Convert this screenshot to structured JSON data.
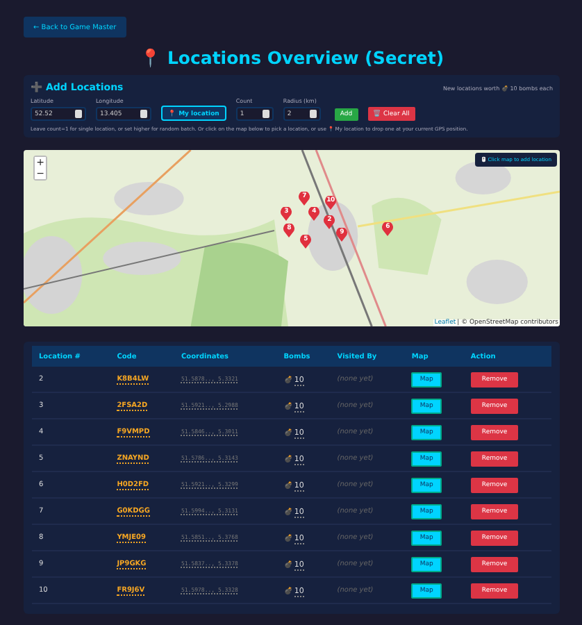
{
  "back_button": "← Back to Game Master",
  "title": {
    "icon": "📍",
    "text": "Locations Overview (Secret)"
  },
  "add_panel": {
    "heading_icon": "➕",
    "heading": "Add Locations",
    "note": "New locations worth 💣 10 bombs each",
    "fields": [
      {
        "label": "Latitude",
        "value": "52.52"
      },
      {
        "label": "Longitude",
        "value": "13.405"
      }
    ],
    "my_location": "📍 My location",
    "fields2": [
      {
        "label": "Count",
        "value": "1"
      },
      {
        "label": "Radius (km)",
        "value": "2"
      }
    ],
    "add": "Add",
    "clear": "🗑️ Clear All",
    "help": "Leave count=1 for single location, or set higher for random batch. Or click on the map below to pick a location, or use 📍 My location to drop one at your current GPS position."
  },
  "map": {
    "zoom_in": "+",
    "zoom_out": "−",
    "hint": "🖱️ Click map to add location",
    "attribution_link": "Leaflet",
    "attribution": "| © OpenStreetMap contributors",
    "markers": [
      "7",
      "10",
      "3",
      "4",
      "2",
      "8",
      "9",
      "5",
      "6"
    ]
  },
  "table": {
    "columns": [
      "Location #",
      "Code",
      "Coordinates",
      "Bombs",
      "Visited By",
      "Map",
      "Action"
    ],
    "rows": [
      {
        "number": "2",
        "code": "K8B4LW",
        "coords": "51.5878.., 5.3321",
        "bomb_icon": "💣",
        "bombs": "10",
        "visited": "(none yet)",
        "map": "Map",
        "action": "Remove"
      },
      {
        "number": "3",
        "code": "2FSA2D",
        "coords": "51.5921.., 5.2988",
        "bomb_icon": "💣",
        "bombs": "10",
        "visited": "(none yet)",
        "map": "Map",
        "action": "Remove"
      },
      {
        "number": "4",
        "code": "F9VMPD",
        "coords": "51.5846.., 5.3011",
        "bomb_icon": "💣",
        "bombs": "10",
        "visited": "(none yet)",
        "map": "Map",
        "action": "Remove"
      },
      {
        "number": "5",
        "code": "ZNAYND",
        "coords": "51.5786.., 5.3143",
        "bomb_icon": "💣",
        "bombs": "10",
        "visited": "(none yet)",
        "map": "Map",
        "action": "Remove"
      },
      {
        "number": "6",
        "code": "H0D2FD",
        "coords": "51.5921.., 5.3299",
        "bomb_icon": "💣",
        "bombs": "10",
        "visited": "(none yet)",
        "map": "Map",
        "action": "Remove"
      },
      {
        "number": "7",
        "code": "G0KDGG",
        "coords": "51.5994.., 5.3131",
        "bomb_icon": "💣",
        "bombs": "10",
        "visited": "(none yet)",
        "map": "Map",
        "action": "Remove"
      },
      {
        "number": "8",
        "code": "YMJE09",
        "coords": "51.5851.., 5.3768",
        "bomb_icon": "💣",
        "bombs": "10",
        "visited": "(none yet)",
        "map": "Map",
        "action": "Remove"
      },
      {
        "number": "9",
        "code": "JP9GKG",
        "coords": "51.5837.., 5.3378",
        "bomb_icon": "💣",
        "bombs": "10",
        "visited": "(none yet)",
        "map": "Map",
        "action": "Remove"
      },
      {
        "number": "10",
        "code": "FR9J6V",
        "coords": "51.5978.., 5.3328",
        "bomb_icon": "💣",
        "bombs": "10",
        "visited": "(none yet)",
        "map": "Map",
        "action": "Remove"
      }
    ]
  }
}
